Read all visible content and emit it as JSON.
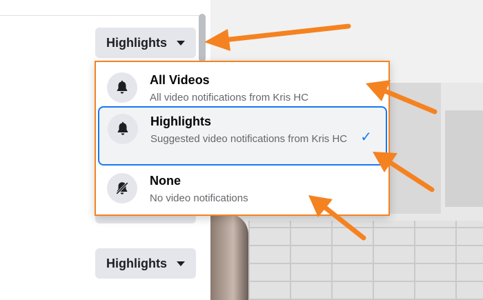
{
  "dropdown_buttons": {
    "top_label": "Highlights",
    "bottom_label": "Highlights"
  },
  "menu": {
    "items": [
      {
        "title": "All Videos",
        "subtitle": "All video notifications from Kris HC",
        "icon": "bell-icon",
        "selected": false
      },
      {
        "title": "Highlights",
        "subtitle": "Suggested video notifications from Kris HC",
        "icon": "bell-icon",
        "selected": true
      },
      {
        "title": "None",
        "subtitle": "No video notifications",
        "icon": "bell-off-icon",
        "selected": false
      }
    ],
    "check_glyph": "✓"
  },
  "colors": {
    "annotation": "#f58220",
    "selection": "#1877f2",
    "button_bg": "#e4e6eb"
  }
}
